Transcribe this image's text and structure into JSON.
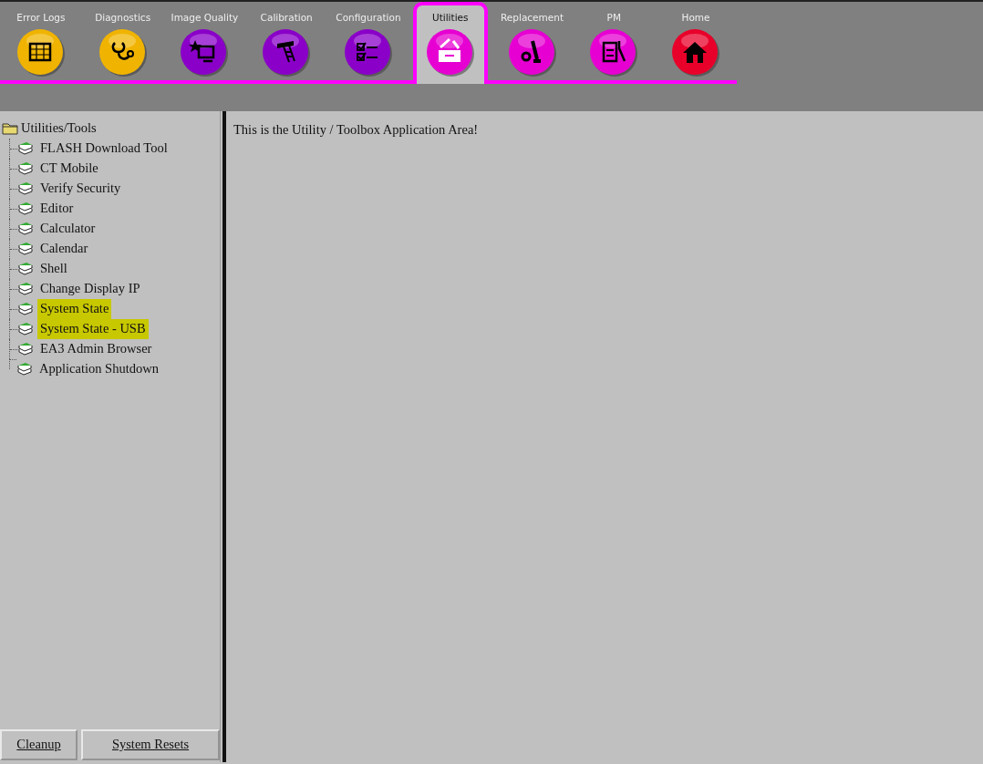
{
  "toolbar": {
    "tabs": [
      {
        "label": "Error Logs",
        "selected": false,
        "color": "#f0b400"
      },
      {
        "label": "Diagnostics",
        "selected": false,
        "color": "#f0b400"
      },
      {
        "label": "Image Quality",
        "selected": false,
        "color": "#8a00c8"
      },
      {
        "label": "Calibration",
        "selected": false,
        "color": "#8a00c8"
      },
      {
        "label": "Configuration",
        "selected": false,
        "color": "#8a00c8"
      },
      {
        "label": "Utilities",
        "selected": true,
        "color": "#e600d2"
      },
      {
        "label": "Replacement",
        "selected": false,
        "color": "#e600d2"
      },
      {
        "label": "PM",
        "selected": false,
        "color": "#e600d2"
      },
      {
        "label": "Home",
        "selected": false,
        "color": "#e8002a"
      }
    ]
  },
  "tree": {
    "label": "Utilities/Tools",
    "children": [
      {
        "label": "FLASH Download Tool",
        "highlighted": false
      },
      {
        "label": "CT Mobile",
        "highlighted": false
      },
      {
        "label": "Verify Security",
        "highlighted": false
      },
      {
        "label": "Editor",
        "highlighted": false
      },
      {
        "label": "Calculator",
        "highlighted": false
      },
      {
        "label": "Calendar",
        "highlighted": false
      },
      {
        "label": "Shell",
        "highlighted": false
      },
      {
        "label": "Change Display IP",
        "highlighted": false
      },
      {
        "label": "System State",
        "highlighted": true
      },
      {
        "label": "System State - USB",
        "highlighted": true
      },
      {
        "label": "EA3 Admin Browser",
        "highlighted": false
      },
      {
        "label": "Application Shutdown",
        "highlighted": false
      }
    ]
  },
  "content": {
    "message": "This is the Utility / Toolbox Application Area!"
  },
  "footer_buttons": [
    "Cleanup",
    "System Resets"
  ]
}
